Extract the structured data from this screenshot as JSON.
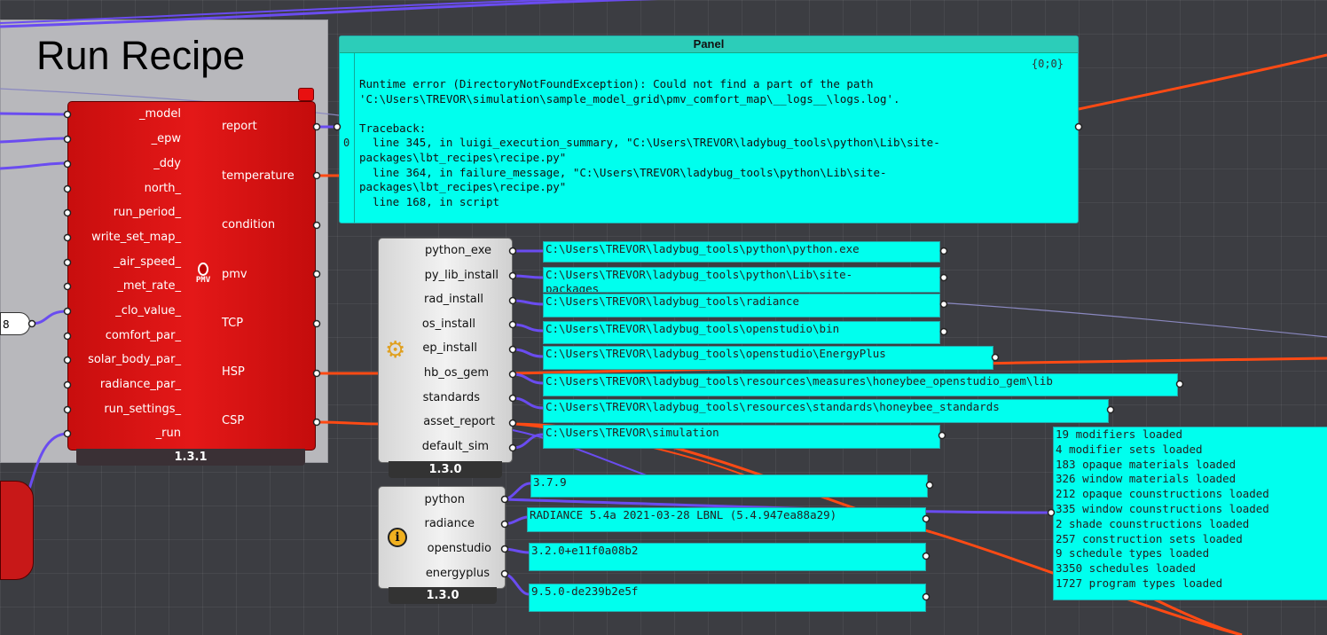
{
  "group": {
    "title": "Run Recipe"
  },
  "run_recipe": {
    "inputs": [
      "_model",
      "_epw",
      "_ddy",
      "north_",
      "run_period_",
      "write_set_map_",
      "_air_speed_",
      "_met_rate_",
      "_clo_value_",
      "comfort_par_",
      "solar_body_par_",
      "radiance_par_",
      "run_settings_",
      "_run"
    ],
    "outputs": [
      "report",
      "temperature",
      "condition",
      "pmv",
      "TCP",
      "HSP",
      "CSP"
    ],
    "icon_label": "PMV",
    "version": "1.3.1"
  },
  "config": {
    "outputs": [
      "python_exe",
      "py_lib_install",
      "rad_install",
      "os_install",
      "ep_install",
      "hb_os_gem",
      "standards",
      "asset_report",
      "default_sim"
    ],
    "icon": "gear-icon",
    "version": "1.3.0"
  },
  "versions": {
    "outputs": [
      "python",
      "radiance",
      "openstudio",
      "energyplus"
    ],
    "icon": "info-icon",
    "version": "1.3.0"
  },
  "number_input": "8",
  "big_panel": {
    "title": "Panel",
    "path": "{0;0}",
    "index": "0",
    "text": "Runtime error (DirectoryNotFoundException): Could not find a part of the path\n'C:\\Users\\TREVOR\\simulation\\sample_model_grid\\pmv_comfort_map\\__logs__\\logs.log'.\n\nTraceback:\n  line 345, in luigi_execution_summary, \"C:\\Users\\TREVOR\\ladybug_tools\\python\\Lib\\site-\npackages\\lbt_recipes\\recipe.py\"\n  line 364, in failure_message, \"C:\\Users\\TREVOR\\ladybug_tools\\python\\Lib\\site-\npackages\\lbt_recipes\\recipe.py\"\n  line 168, in script"
  },
  "path_panels": [
    "C:\\Users\\TREVOR\\ladybug_tools\\python\\python.exe",
    "C:\\Users\\TREVOR\\ladybug_tools\\python\\Lib\\site-\npackages",
    "C:\\Users\\TREVOR\\ladybug_tools\\radiance",
    "C:\\Users\\TREVOR\\ladybug_tools\\openstudio\\bin",
    "C:\\Users\\TREVOR\\ladybug_tools\\openstudio\\EnergyPlus",
    "C:\\Users\\TREVOR\\ladybug_tools\\resources\\measures\\honeybee_openstudio_gem\\lib",
    "C:\\Users\\TREVOR\\ladybug_tools\\resources\\standards\\honeybee_standards",
    "C:\\Users\\TREVOR\\simulation"
  ],
  "version_panels": [
    "3.7.9",
    "RADIANCE 5.4a 2021-03-28 LBNL (5.4.947ea88a29)",
    "3.2.0+e11f0a08b2",
    "9.5.0-de239b2e5f"
  ],
  "asset_panel": "19 modifiers loaded\n4 modifier sets loaded\n183 opaque materials loaded\n326 window materials loaded\n212 opaque counstructions loaded\n335 window counstructions loaded\n2 shade counstructions loaded\n257 construction sets loaded\n9 schedule types loaded\n3350 schedules loaded\n1727 program types loaded",
  "colors": {
    "canvas": "#3c3d42",
    "panel": "#00ffee",
    "component_red": "#d81414",
    "wire_purple": "#6a4cf0",
    "wire_orange": "#ff4a14"
  }
}
